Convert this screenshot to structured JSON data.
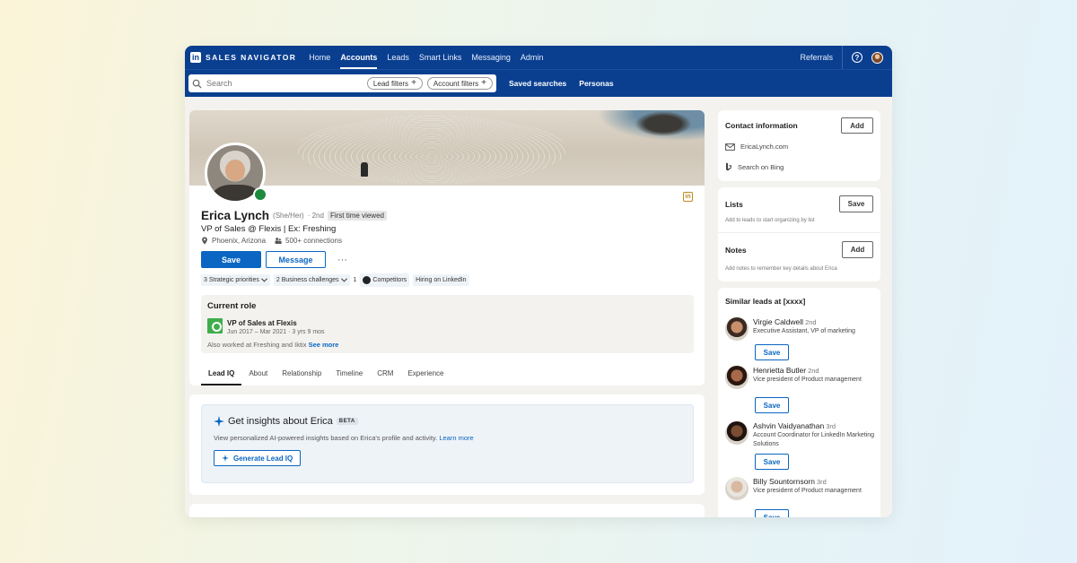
{
  "nav": {
    "logo_mark": "in",
    "brand": "SALES NAVIGATOR",
    "items": [
      {
        "label": "Home"
      },
      {
        "label": "Accounts"
      },
      {
        "label": "Leads"
      },
      {
        "label": "Smart Links"
      },
      {
        "label": "Messaging"
      },
      {
        "label": "Admin"
      }
    ],
    "active_item": "Accounts",
    "referrals": "Referrals",
    "help_icon": "question-circle-icon"
  },
  "search": {
    "placeholder": "Search",
    "lead_filters": "Lead filters",
    "account_filters": "Account filters",
    "saved_searches": "Saved searches",
    "personas": "Personas"
  },
  "profile": {
    "name": "Erica Lynch",
    "pronouns": "(She/Her)",
    "degree": "· 2nd",
    "first_viewed": "First time viewed",
    "headline": "VP of Sales @ Flexis | Ex: Freshing",
    "location": "Phoenix, Arizona",
    "connections": "500+ connections",
    "save_label": "Save",
    "message_label": "Message",
    "more_label": "···",
    "in_badge": "in",
    "chips": [
      {
        "label": "3 Strategic priorities"
      },
      {
        "label": "2 Business challenges"
      },
      {
        "label": "Competitors"
      },
      {
        "label": "Hiring on LinkedIn"
      }
    ],
    "chip_prefix": "1",
    "current_role": {
      "heading": "Current role",
      "role": "VP of Sales at Flexis",
      "dates": "Jun 2017 – Mar 2021 · 3 yrs 9 mos",
      "also_worked": "Also worked at Freshing and Iktix",
      "see_more": "See more"
    },
    "tabs": [
      {
        "label": "Lead IQ"
      },
      {
        "label": "About"
      },
      {
        "label": "Relationship"
      },
      {
        "label": "Timeline"
      },
      {
        "label": "CRM"
      },
      {
        "label": "Experience"
      }
    ],
    "active_tab": "Lead IQ"
  },
  "insights": {
    "title": "Get insights about Erica",
    "beta": "BETA",
    "description": "View personalized AI-powered insights based on Erica's profile and activity.",
    "learn_more": "Learn more",
    "generate_label": "Generate Lead IQ"
  },
  "contact": {
    "title": "Contact information",
    "add_label": "Add",
    "website": "EricaLynch.com",
    "bing": "Search on Bing"
  },
  "lists": {
    "title": "Lists",
    "save_label": "Save",
    "subtitle": "Add to leads to start organizing by list"
  },
  "notes": {
    "title": "Notes",
    "add_label": "Add",
    "subtitle": "Add notes to remember key details about Erica"
  },
  "similar": {
    "title": "Similar leads at [xxxx]",
    "leads": [
      {
        "name": "Virgie Caldwell",
        "degree": "2nd",
        "title": "Executive Assistant, VP of marketing",
        "save": "Save",
        "skin": "#c98f6b",
        "hair": "#3a2a22"
      },
      {
        "name": "Henrietta Butler",
        "degree": "2nd",
        "title": "Vice president of Product management",
        "save": "Save",
        "skin": "#a7694a",
        "hair": "#2a1810"
      },
      {
        "name": "Ashvin Vaidyanathan",
        "degree": "3rd",
        "title": "Account Coordinator for LinkedIn Marketing Solutions",
        "save": "Save",
        "skin": "#7a4c33",
        "hair": "#1e1410"
      },
      {
        "name": "Billy Sountornsorn",
        "degree": "3rd",
        "title": "Vice president of Product management",
        "save": "Save",
        "skin": "#d8b9a0",
        "hair": "#e8e4de"
      }
    ]
  },
  "colors": {
    "nav_bg": "#0a3f90",
    "primary": "#0a66c2",
    "online": "#1c8a3e"
  }
}
